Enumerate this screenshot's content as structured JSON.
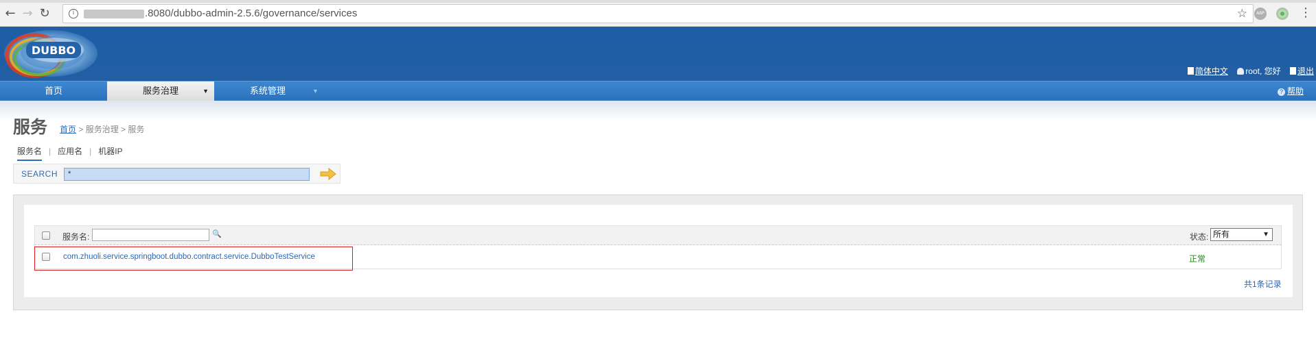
{
  "browser": {
    "url_prefix": "...",
    "url_rest": ".8080/dubbo-admin-2.5.6/governance/services",
    "extensions": [
      "ABP",
      "green-circle"
    ]
  },
  "header": {
    "logo_text": "DUBBO",
    "language": "简体中文",
    "user": "root, 您好",
    "logout": "退出"
  },
  "nav": {
    "items": [
      {
        "label": "首页"
      },
      {
        "label": "服务治理"
      },
      {
        "label": "系统管理"
      }
    ],
    "help": "帮助"
  },
  "page": {
    "title": "服务",
    "breadcrumb_home": "首页",
    "breadcrumb_rest": " > 服务治理 > 服务"
  },
  "search": {
    "tabs": [
      "服务名",
      "应用名",
      "机器IP"
    ],
    "label": "SEARCH",
    "value": "*"
  },
  "table": {
    "name_label": "服务名:",
    "status_label": "状态:",
    "status_value": "所有",
    "rows": [
      {
        "service": "com.zhuoli.service.springboot.dubbo.contract.service.DubboTestService",
        "status": "正常"
      }
    ],
    "count": "共1条记录"
  }
}
